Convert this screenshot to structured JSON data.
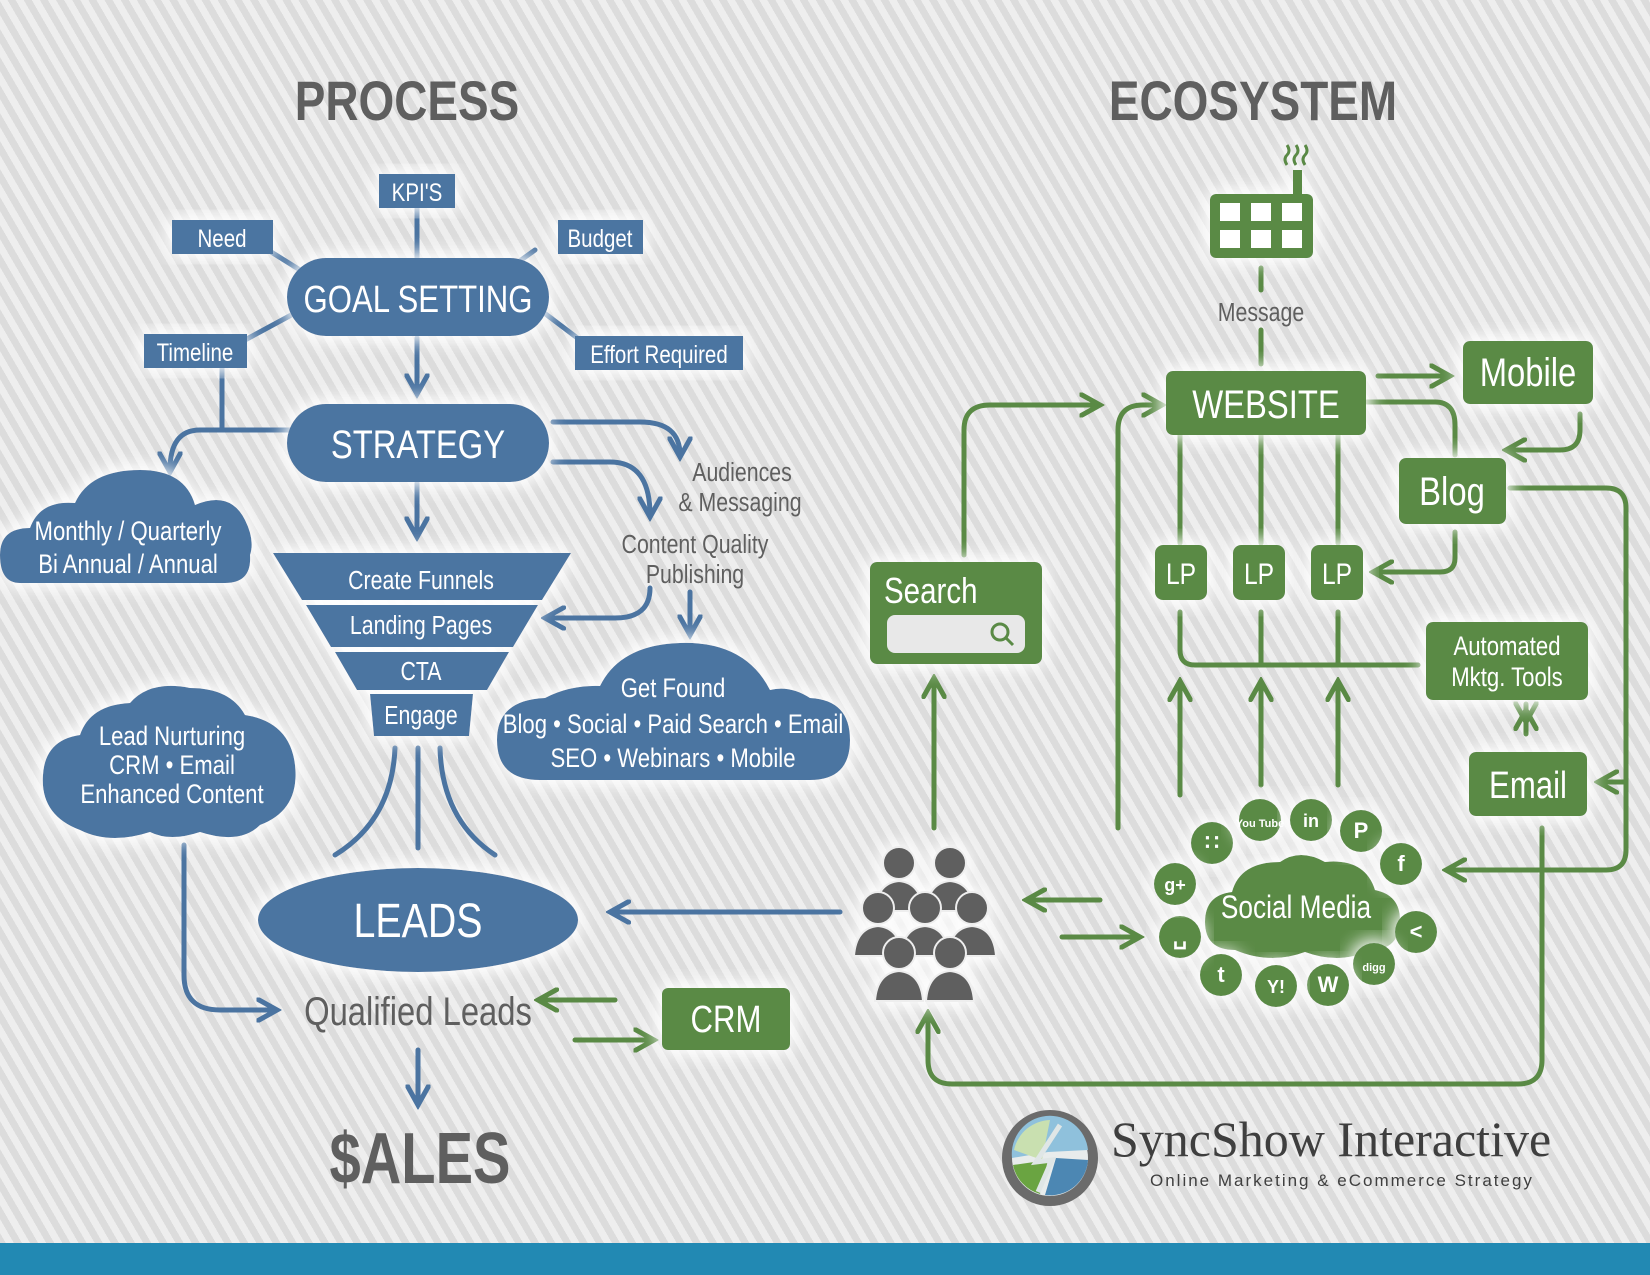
{
  "colors": {
    "blue": "#4b74a1",
    "green": "#5a8a45",
    "gray_text": "#5f5f5f",
    "footer": "#2289b3",
    "white": "#ffffff"
  },
  "headers": {
    "process": "PROCESS",
    "ecosystem": "ECOSYSTEM"
  },
  "process": {
    "goal_setting": "GOAL SETTING",
    "goal_factors": {
      "kpis": "KPI'S",
      "need": "Need",
      "budget": "Budget",
      "timeline": "Timeline",
      "effort": "Effort Required"
    },
    "strategy": "STRATEGY",
    "frequency_cloud": [
      "Monthly / Quarterly",
      "Bi Annual / Annual"
    ],
    "audiences": [
      "Audiences",
      "& Messaging"
    ],
    "content": [
      "Content Quality",
      "Publishing"
    ],
    "funnel": [
      "Create Funnels",
      "Landing Pages",
      "CTA",
      "Engage"
    ],
    "get_found_cloud": [
      "Get Found",
      "Blog • Social • Paid Search • Email",
      "SEO • Webinars • Mobile"
    ],
    "nurture_cloud": [
      "Lead Nurturing",
      "CRM • Email",
      "Enhanced Content"
    ],
    "leads": "LEADS",
    "qualified_leads": "Qualified Leads",
    "crm": "CRM",
    "sales": "$ALES"
  },
  "ecosystem": {
    "message": "Message",
    "website": "WEBSITE",
    "mobile": "Mobile",
    "blog": "Blog",
    "lp": "LP",
    "search": "Search",
    "automated": [
      "Automated",
      "Mktg. Tools"
    ],
    "email": "Email",
    "social_media": "Social Media",
    "social_icons": [
      {
        "name": "rss-icon",
        "glyph": "∷"
      },
      {
        "name": "youtube-icon",
        "glyph": "You Tube"
      },
      {
        "name": "linkedin-icon",
        "glyph": "in"
      },
      {
        "name": "pinterest-icon",
        "glyph": "P"
      },
      {
        "name": "facebook-icon",
        "glyph": "f"
      },
      {
        "name": "share-icon",
        "glyph": "<"
      },
      {
        "name": "digg-icon",
        "glyph": "digg"
      },
      {
        "name": "wordpress-icon",
        "glyph": "W"
      },
      {
        "name": "yahoo-icon",
        "glyph": "Y!"
      },
      {
        "name": "twitter-icon",
        "glyph": "t"
      },
      {
        "name": "myspace-icon",
        "glyph": "␣"
      },
      {
        "name": "googleplus-icon",
        "glyph": "g+"
      }
    ]
  },
  "brand": {
    "name": "SyncShow Interactive",
    "tagline": "Online Marketing & eCommerce Strategy"
  }
}
